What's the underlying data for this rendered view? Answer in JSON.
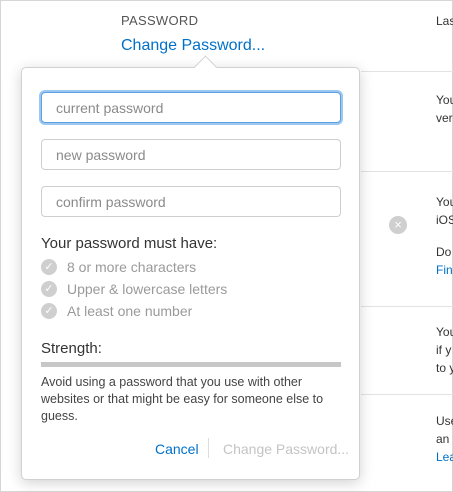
{
  "page": {
    "section_label": "PASSWORD",
    "change_link": "Change Password...",
    "right_column": [
      {
        "lines": [
          "Las"
        ]
      },
      {
        "lines": [
          "You",
          "ver"
        ]
      },
      {
        "lines": [
          "You",
          "iOS",
          "",
          "Do",
          "Fin"
        ],
        "link_index": 4
      },
      {
        "lines": [
          "You",
          "if y",
          "to y"
        ]
      },
      {
        "lines": [
          "Use",
          "an",
          "Lea"
        ],
        "link_index": 2
      }
    ],
    "dismiss_glyph": "×"
  },
  "popover": {
    "current_password": {
      "placeholder": "current password",
      "value": ""
    },
    "new_password": {
      "placeholder": "new password",
      "value": ""
    },
    "confirm_password": {
      "placeholder": "confirm password",
      "value": ""
    },
    "requirements_title": "Your password must have:",
    "requirements": [
      {
        "text": "8 or more characters",
        "met": false
      },
      {
        "text": "Upper & lowercase letters",
        "met": false
      },
      {
        "text": "At least one number",
        "met": false
      }
    ],
    "check_glyph": "✓",
    "strength_label": "Strength:",
    "strength_level": 0,
    "advice": "Avoid using a password that you use with other websites or that might be easy for someone else to guess.",
    "cancel_label": "Cancel",
    "submit_label": "Change Password..."
  },
  "colors": {
    "link": "#0070c9",
    "focus_ring": "#9cc7f0",
    "disabled_text": "#c4c4c4",
    "check_inactive": "#cfcfcf"
  }
}
